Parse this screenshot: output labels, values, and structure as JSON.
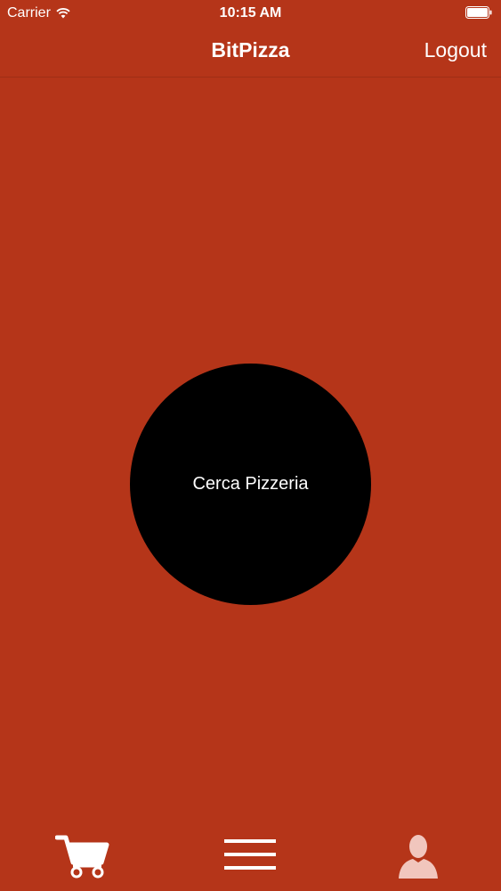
{
  "status_bar": {
    "carrier": "Carrier",
    "time": "10:15 AM",
    "icons": [
      "wifi-icon",
      "battery-icon"
    ]
  },
  "nav": {
    "title": "BitPizza",
    "logout_label": "Logout"
  },
  "main": {
    "search_button_label": "Cerca Pizzeria"
  },
  "tab_bar": {
    "tabs": [
      {
        "icon": "cart-icon"
      },
      {
        "icon": "menu-icon"
      },
      {
        "icon": "user-icon"
      }
    ]
  },
  "colors": {
    "background": "#b53519",
    "circle": "#000000",
    "text": "#ffffff",
    "profile_icon": "#f1c6bd"
  }
}
